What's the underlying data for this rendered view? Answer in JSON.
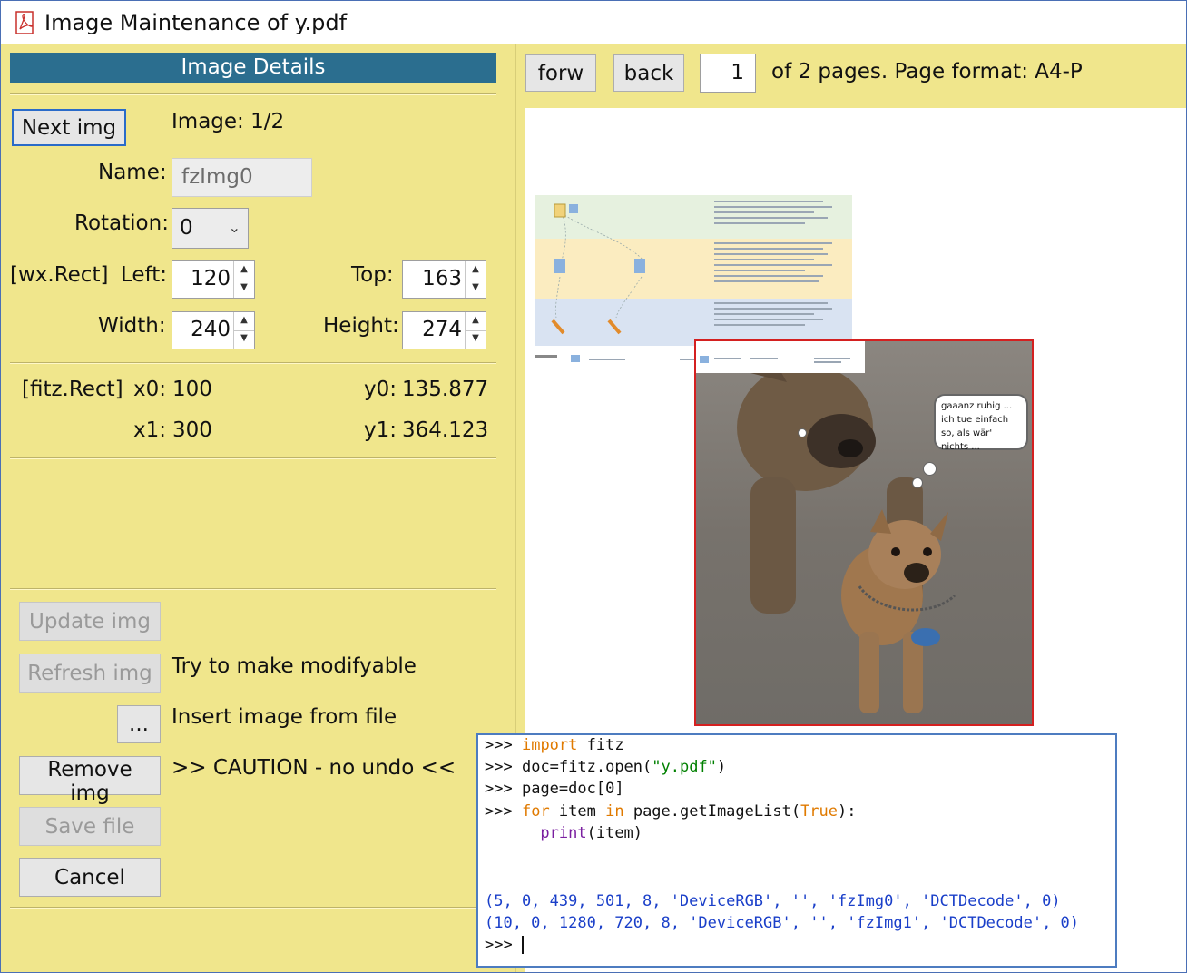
{
  "window": {
    "title": "Image Maintenance of y.pdf",
    "icon": "pdf-icon"
  },
  "details": {
    "header": "Image Details",
    "next_img": "Next img",
    "image_counter": "Image: 1/2",
    "name_label": "Name:",
    "name_value": "fzImg0",
    "rotation_label": "Rotation:",
    "rotation_value": "0",
    "wx_label": "[wx.Rect]",
    "left_label": "Left:",
    "left_value": "120",
    "top_label": "Top:",
    "top_value": "163",
    "width_label": "Width:",
    "width_value": "240",
    "height_label": "Height:",
    "height_value": "274",
    "fitz_label": "[fitz.Rect]",
    "x0_label": "x0:",
    "x0_value": "100",
    "y0_label": "y0:",
    "y0_value": "135.877",
    "x1_label": "x1:",
    "x1_value": "300",
    "y1_label": "y1:",
    "y1_value": "364.123"
  },
  "actions": {
    "update": "Update img",
    "refresh": "Refresh img",
    "refresh_hint": "Try to make modifyable",
    "browse": "...",
    "insert_hint": "Insert image from file",
    "remove": "Remove img",
    "caution": ">> CAUTION - no undo <<",
    "save": "Save file",
    "cancel": "Cancel"
  },
  "nav": {
    "forw": "forw",
    "back": "back",
    "page_number": "1",
    "page_info": "of 2 pages.  Page format: A4-P"
  },
  "page": {
    "bubble_text": "gaaanz ruhig ... ich tue einfach so, als wär' nichts ..."
  },
  "console": {
    "prompt": ">>>",
    "line1_kw": "import",
    "line1_rest": " fitz",
    "line2_a": "doc=fitz.open(",
    "line2_str": "\"y.pdf\"",
    "line2_b": ")",
    "line3": "page=doc[0]",
    "line4_for": "for",
    "line4_a": " item ",
    "line4_in": "in",
    "line4_b": " page.getImageList(",
    "line4_true": "True",
    "line4_c": "):",
    "line5_print": "print",
    "line5_rest": "(item)",
    "out1": "(5, 0, 439, 501, 8, 'DeviceRGB', '', 'fzImg0', 'DCTDecode', 0)",
    "out2": "(10, 0, 1280, 720, 8, 'DeviceRGB', '', 'fzImg1', 'DCTDecode', 0)"
  },
  "colors": {
    "panel": "#f0e68c",
    "header": "#2b6e8f",
    "image_border": "#d42020",
    "console_border": "#4d7cc0"
  }
}
